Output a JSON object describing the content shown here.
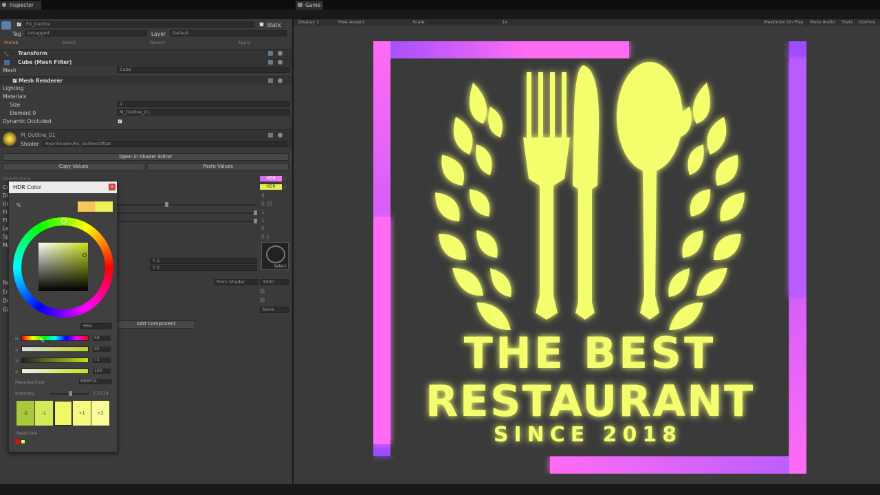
{
  "inspector": {
    "tab": "Inspector",
    "object_name": "FX_Outline",
    "static_label": "Static",
    "tag_label": "Tag",
    "tag_value": "Untagged",
    "layer_label": "Layer",
    "layer_value": "Default",
    "prefab_label": "Prefab",
    "select_label": "Select",
    "revert_label": "Revert",
    "apply_label": "Apply",
    "transform": "Transform",
    "mesh_filter": "Cube (Mesh Filter)",
    "mesh_label": "Mesh",
    "mesh_value": "Cube",
    "mesh_renderer": "Mesh Renderer",
    "lighting": "Lighting",
    "materials": "Materials",
    "size_label": "Size",
    "size_value": "1",
    "element0_label": "Element 0",
    "element0_value": "M_Outline_01",
    "dynamic_occluded": "Dynamic Occluded",
    "material_name": "M_Outline_01",
    "shader_label": "Shader",
    "shader_value": "RyanShader/Rs_OutlineOffset",
    "open_shader_editor": "Open in Shader Editor",
    "copy_values": "Copy Values",
    "paste_values": "Paste Values",
    "color_outline": "ColorOutline",
    "hdr_label": "HDR",
    "values": [
      "4",
      "0.35",
      "1",
      "1",
      "0",
      "0.5"
    ],
    "tiling_y": "Y 1",
    "offset_y": "Y 0",
    "select_tex": "Select",
    "from_shader": "From Shader",
    "queue_value": "3000",
    "none_label": "None",
    "add_component": "Add Component",
    "side_labels": [
      "Co",
      "Di",
      "Un",
      "Fl",
      "Fl",
      "Le",
      "Sp",
      "Ma",
      "Re",
      "En",
      "Do",
      "Gl"
    ]
  },
  "hdr_popup": {
    "title": "HDR Color",
    "close": "x",
    "mode": "HSV",
    "channels": [
      {
        "label": "H",
        "value": "69"
      },
      {
        "label": "S",
        "value": "95"
      },
      {
        "label": "V",
        "value": "75"
      },
      {
        "label": "A",
        "value": "100"
      }
    ],
    "hex_label": "Hexadecimal",
    "hex_value": "BBBF0A",
    "intensity_label": "Intensity",
    "intensity_value": "2.5119",
    "swatches_stops": [
      "-2",
      "-1",
      "",
      "+1",
      "+2"
    ],
    "swatches_label": "Swatches"
  },
  "game": {
    "tab": "Game",
    "display": "Display 1",
    "aspect": "Free Aspect",
    "scale_label": "Scale",
    "scale_value": "1x",
    "maximize": "Maximize On Play",
    "mute": "Mute Audio",
    "stats": "Stats",
    "gizmos": "Gizmos"
  },
  "sign": {
    "line1": "THE BEST",
    "line2": "RESTAURANT",
    "line3": "SINCE 2018"
  },
  "colors": {
    "neon_yellow": "#f4ff6e",
    "neon_pink": "#ff6cf4",
    "neon_purple": "#9c4dff",
    "panel": "#3a3a3a"
  }
}
